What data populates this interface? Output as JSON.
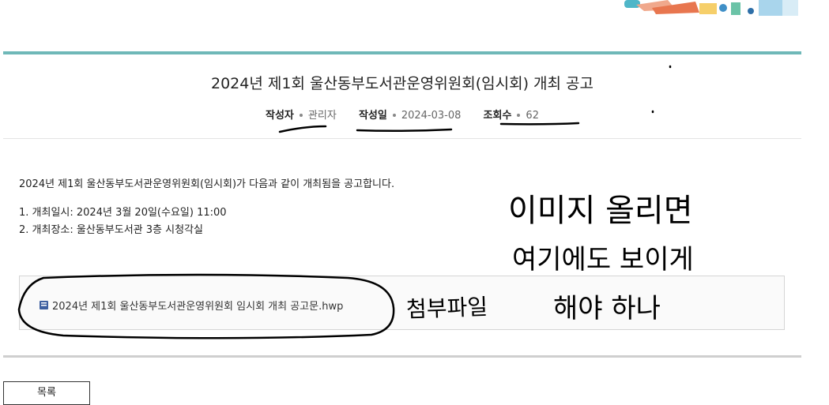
{
  "post": {
    "title": "2024년 제1회 울산동부도서관운영위원회(임시회) 개최 공고",
    "meta": [
      {
        "label": "작성자",
        "value": "관리자"
      },
      {
        "label": "작성일",
        "value": "2024-03-08"
      },
      {
        "label": "조회수",
        "value": "62"
      }
    ],
    "body": {
      "intro": "2024년 제1회 울산동부도서관운영위원회(임시회)가 다음과 같이 개최됨을 공고합니다.",
      "items": [
        "1. 개최일시: 2024년 3월 20일(수요일) 11:00",
        "2. 개최장소: 울산동부도서관 3층 시청각실"
      ]
    },
    "attachment": {
      "filename": "2024년 제1회 울산동부도서관운영위원회 임시회 개최 공고문.hwp",
      "icon": "file-icon"
    },
    "list_button": "목록"
  },
  "colors": {
    "accent_line": "#6fb8b8",
    "annotation_ink": "#000000"
  },
  "annotations": {
    "note_attachment": "첨부파일",
    "note_right": "이미지 올리면 여기에도 보이게 해야 하나"
  }
}
